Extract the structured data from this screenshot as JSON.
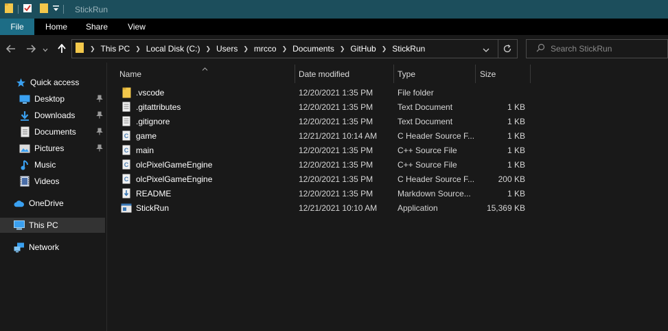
{
  "window": {
    "title": "StickRun"
  },
  "ribbon": {
    "tabs": [
      "File",
      "Home",
      "Share",
      "View"
    ]
  },
  "address": {
    "crumbs": [
      "This PC",
      "Local Disk (C:)",
      "Users",
      "mrcco",
      "Documents",
      "GitHub",
      "StickRun"
    ]
  },
  "search": {
    "placeholder": "Search StickRun"
  },
  "sidebar": {
    "items": [
      {
        "label": "Quick access",
        "icon": "star-icon",
        "pinned": false
      },
      {
        "label": "Desktop",
        "icon": "desktop-icon",
        "pinned": true
      },
      {
        "label": "Downloads",
        "icon": "download-icon",
        "pinned": true
      },
      {
        "label": "Documents",
        "icon": "documents-icon",
        "pinned": true
      },
      {
        "label": "Pictures",
        "icon": "pictures-icon",
        "pinned": true
      },
      {
        "label": "Music",
        "icon": "music-icon",
        "pinned": false
      },
      {
        "label": "Videos",
        "icon": "videos-icon",
        "pinned": false
      },
      {
        "label": "OneDrive",
        "icon": "cloud-icon",
        "pinned": false
      },
      {
        "label": "This PC",
        "icon": "computer-icon",
        "pinned": false,
        "selected": true
      },
      {
        "label": "Network",
        "icon": "network-icon",
        "pinned": false
      }
    ]
  },
  "columns": {
    "name": "Name",
    "date": "Date modified",
    "type": "Type",
    "size": "Size"
  },
  "files": [
    {
      "name": ".vscode",
      "date": "12/20/2021 1:35 PM",
      "type": "File folder",
      "size": "",
      "icon": "folder-icon"
    },
    {
      "name": ".gitattributes",
      "date": "12/20/2021 1:35 PM",
      "type": "Text Document",
      "size": "1 KB",
      "icon": "text-file-icon"
    },
    {
      "name": ".gitignore",
      "date": "12/20/2021 1:35 PM",
      "type": "Text Document",
      "size": "1 KB",
      "icon": "text-file-icon"
    },
    {
      "name": "game",
      "date": "12/21/2021 10:14 AM",
      "type": "C Header Source F...",
      "size": "1 KB",
      "icon": "c-file-icon"
    },
    {
      "name": "main",
      "date": "12/20/2021 1:35 PM",
      "type": "C++ Source File",
      "size": "1 KB",
      "icon": "c-file-icon"
    },
    {
      "name": "olcPixelGameEngine",
      "date": "12/20/2021 1:35 PM",
      "type": "C++ Source File",
      "size": "1 KB",
      "icon": "c-file-icon"
    },
    {
      "name": "olcPixelGameEngine",
      "date": "12/20/2021 1:35 PM",
      "type": "C Header Source F...",
      "size": "200 KB",
      "icon": "c-file-icon"
    },
    {
      "name": "README",
      "date": "12/20/2021 1:35 PM",
      "type": "Markdown Source...",
      "size": "1 KB",
      "icon": "markdown-file-icon"
    },
    {
      "name": "StickRun",
      "date": "12/21/2021 10:10 AM",
      "type": "Application",
      "size": "15,369 KB",
      "icon": "application-icon"
    }
  ],
  "colors": {
    "titlebar": "#1c4e5c",
    "file_tab": "#1d6d86",
    "background": "#191919",
    "folder": "#f3c84b",
    "accent_blue": "#3aa0f0"
  }
}
